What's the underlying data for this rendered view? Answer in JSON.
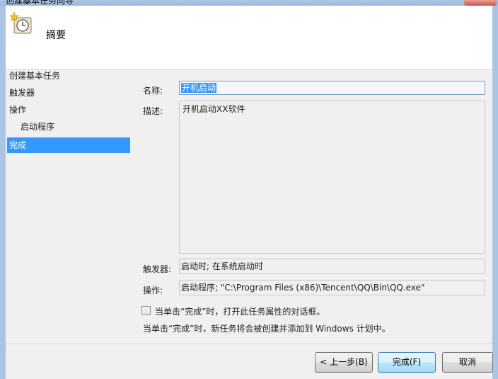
{
  "window": {
    "title": "创建基本任务向导"
  },
  "header": {
    "title": "摘要"
  },
  "nav": {
    "items": [
      {
        "label": "创建基本任务",
        "active": false,
        "sub": false
      },
      {
        "label": "触发器",
        "active": false,
        "sub": false
      },
      {
        "label": "操作",
        "active": false,
        "sub": false
      },
      {
        "label": "启动程序",
        "active": false,
        "sub": true
      },
      {
        "label": "完成",
        "active": true,
        "sub": false
      }
    ]
  },
  "form": {
    "name_label": "名称:",
    "name_value": "开机启动",
    "desc_label": "描述:",
    "desc_value": "开机启动XX软件",
    "trigger_label": "触发器:",
    "trigger_value": "启动时; 在系统启动时",
    "action_label": "操作:",
    "action_value": "启动程序; \"C:\\Program Files (x86)\\Tencent\\QQ\\Bin\\QQ.exe\"",
    "checkbox_label": "当单击“完成”时，打开此任务属性的对话框。",
    "checkbox_checked": false,
    "info_text": "当单击“完成”时，新任务将会被创建并添加到 Windows 计划中。"
  },
  "buttons": {
    "back": "< 上一步(B)",
    "finish": "完成(F)",
    "cancel": "取消"
  },
  "colors": {
    "selection": "#3399ff",
    "frame": "#a9c4e6"
  }
}
